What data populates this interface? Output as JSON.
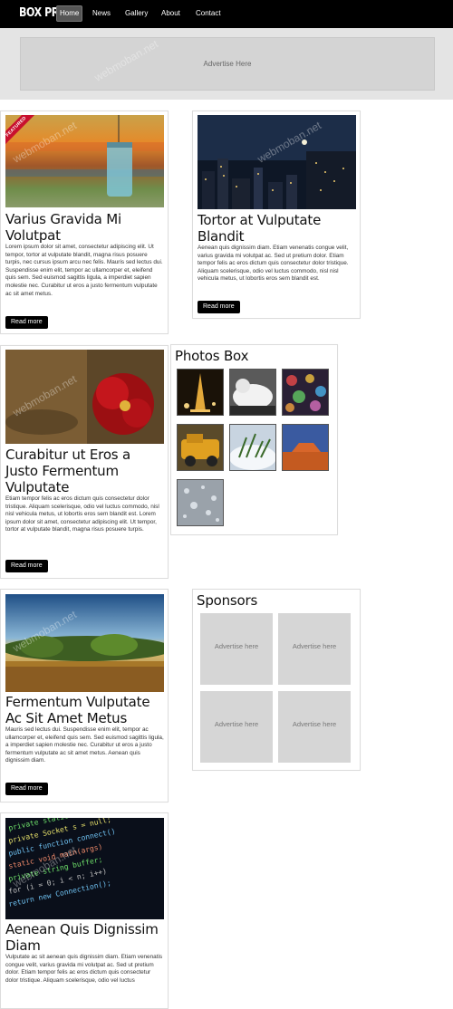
{
  "header": {
    "logo": "BOX PRE",
    "nav": [
      {
        "label": "Home",
        "active": true
      },
      {
        "label": "News",
        "active": false
      },
      {
        "label": "Gallery",
        "active": false
      },
      {
        "label": "About",
        "active": false
      },
      {
        "label": "Contact",
        "active": false
      }
    ]
  },
  "banner": {
    "text": "Advertise Here"
  },
  "posts": [
    {
      "badge": "FEATURED",
      "title": "Varius Gravida Mi Volutpat",
      "excerpt": "Lorem ipsum dolor sit amet, consectetur adipiscing elit. Ut tempor, tortor at vulputate blandit, magna risus posuere turpis, nec cursus ipsum arcu nec felis. Mauris sed lectus dui. Suspendisse enim elit, tempor ac ullamcorper et, eleifend quis sem. Sed euismod sagittis ligula, a imperdiet sapien molestie nec. Curabitur ut eros a justo fermentum vulputate ac sit amet metus.",
      "button": "Read more",
      "image": "glass-jar-photo"
    },
    {
      "title": "Tortor at Vulputate Blandit",
      "excerpt": "Aenean quis dignissim diam. Etiam venenatis congue velit, varius gravida mi volutpat ac. Sed ut pretium dolor. Etiam tempor felis ac eros dictum quis consectetur dolor tristique. Aliquam scelerisque, odio vel luctus commodo, nisl nisl vehicula metus, ut lobortis eros sem blandit est.",
      "button": "Read more",
      "image": "night-city-photo"
    },
    {
      "title": "Curabitur ut Eros a Justo Fermentum Vulputate",
      "excerpt": "Etiam tempor felis ac eros dictum quis consectetur dolor tristique. Aliquam scelerisque, odio vel luctus commodo, nisl nisl vehicula metus, ut lobortis eros sem blandit est. Lorem ipsum dolor sit amet, consectetur adipiscing elit. Ut tempor, tortor at vulputate blandit, magna risus posuere turpis.",
      "button": "Read more",
      "image": "red-flower-photo"
    },
    {
      "title": "Fermentum Vulputate Ac Sit Amet Metus",
      "excerpt": "Mauris sed lectus dui. Suspendisse enim elit, tempor ac ullamcorper et, eleifend quis sem. Sed euismod sagittis ligula, a imperdiet sapien molestie nec. Curabitur ut eros a justo fermentum vulputate ac sit amet metus. Aenean quis dignissim diam.",
      "button": "Read more",
      "image": "landscape-photo"
    },
    {
      "title": "Aenean Quis Dignissim Diam",
      "excerpt": "Vulputate ac sit aenean quis dignissim diam. Etiam venenatis congue velit, varius gravida mi volutpat ac. Sed ut pretium dolor. Etiam tempor felis ac eros dictum quis consectetur dolor tristique. Aliquam scelerisque, odio vel luctus",
      "button": "",
      "image": "code-screen-photo"
    }
  ],
  "photos_box": {
    "title": "Photos Box",
    "photos": [
      "eiffel-tower-photo",
      "snow-photo",
      "bokeh-lights-photo",
      "old-truck-photo",
      "snowy-grass-photo",
      "desert-rock-photo",
      "water-drops-photo"
    ]
  },
  "sponsors": {
    "title": "Sponsors",
    "ads": [
      "Advertise here",
      "Advertise here",
      "Advertise here",
      "Advertise here"
    ]
  },
  "watermark": "webmoban.net",
  "colors": {
    "topbar": "#000000",
    "banner_bg": "#e4e4e4",
    "ribbon": "#c8102e",
    "button": "#000000"
  }
}
